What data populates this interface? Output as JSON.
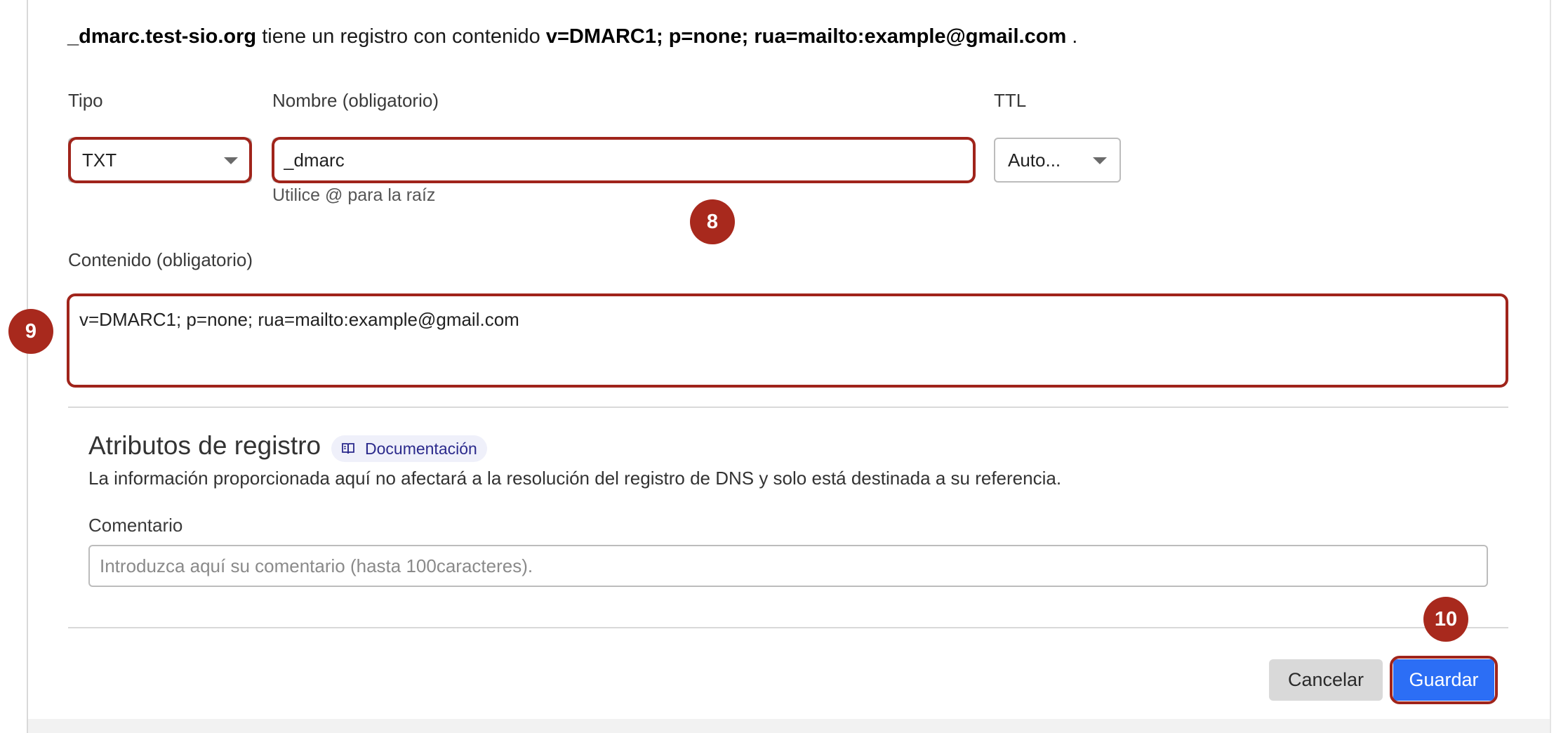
{
  "intro": {
    "domain": "_dmarc.test-sio.org",
    "middle": " tiene un registro con contenido ",
    "content": "v=DMARC1; p=none; rua=mailto:example@gmail.com",
    "end": " ."
  },
  "form": {
    "type": {
      "label": "Tipo",
      "value": "TXT"
    },
    "name": {
      "label": "Nombre (obligatorio)",
      "value": "_dmarc",
      "hint": "Utilice @ para la raíz"
    },
    "ttl": {
      "label": "TTL",
      "value": "Auto..."
    },
    "content": {
      "label": "Contenido (obligatorio)",
      "value": "v=DMARC1; p=none; rua=mailto:example@gmail.com"
    }
  },
  "attributes": {
    "title": "Atributos de registro",
    "doc_label": "Documentación",
    "description": "La información proporcionada aquí no afectará a la resolución del registro de DNS y solo está destinada a su referencia.",
    "comment_label": "Comentario",
    "comment_placeholder": "Introduzca aquí su comentario (hasta 100caracteres)."
  },
  "buttons": {
    "cancel": "Cancelar",
    "save": "Guardar"
  },
  "markers": {
    "name": "8",
    "content": "9",
    "save": "10"
  },
  "colors": {
    "highlight": "#a0241b",
    "marker": "#a8291d",
    "primary": "#2c6ef5",
    "badge_text": "#2b2a8c"
  },
  "icons": {
    "type_caret": "chevron-down-icon",
    "ttl_caret": "chevron-down-icon",
    "doc": "book-icon"
  }
}
